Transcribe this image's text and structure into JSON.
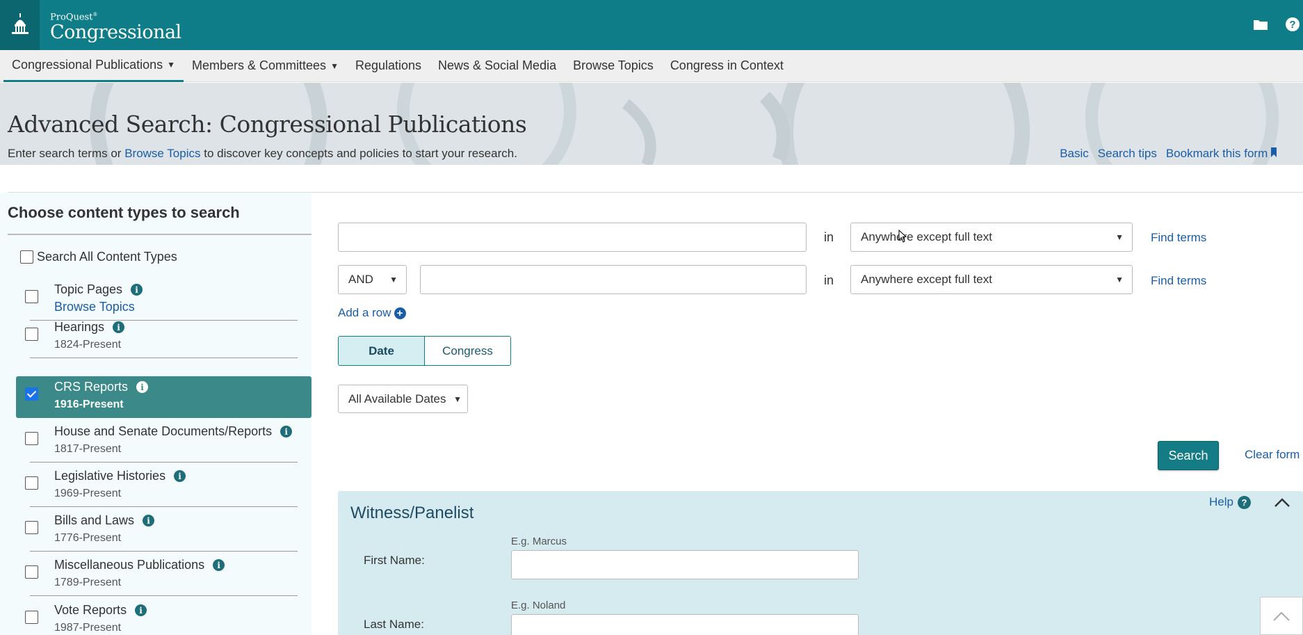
{
  "brand": {
    "small": "ProQuest",
    "big": "Congressional"
  },
  "nav": [
    {
      "label": "Congressional Publications",
      "caret": "▼"
    },
    {
      "label": "Members & Committees",
      "caret": "▼"
    },
    {
      "label": "Regulations"
    },
    {
      "label": "News & Social Media"
    },
    {
      "label": "Browse Topics"
    },
    {
      "label": "Congress in Context"
    }
  ],
  "hero": {
    "title": "Advanced Search: Congressional Publications",
    "sub_pre": "Enter search terms or",
    "sub_link": "Browse Topics",
    "sub_post": "to discover key concepts and policies to start your research.",
    "links": {
      "basic": "Basic",
      "tips": "Search tips",
      "bookmark": "Bookmark this form"
    }
  },
  "sidebar": {
    "heading": "Choose content types to search",
    "all_label": "Search All Content Types",
    "items": [
      {
        "name": "Topic Pages",
        "sub": "Browse Topics"
      },
      {
        "name": "Hearings",
        "sub": "1824-Present"
      },
      {
        "name": "CRS Reports",
        "sub": "1916-Present"
      },
      {
        "name": "House and Senate Documents/Reports",
        "sub": "1817-Present"
      },
      {
        "name": "Legislative Histories",
        "sub": "1969-Present"
      },
      {
        "name": "Bills and Laws",
        "sub": "1776-Present"
      },
      {
        "name": "Miscellaneous Publications",
        "sub": "1789-Present"
      },
      {
        "name": "Vote Reports",
        "sub": "1987-Present"
      }
    ]
  },
  "form": {
    "row1": {
      "value": "",
      "in": "in",
      "field": "Anywhere except full text",
      "find": "Find terms"
    },
    "row2": {
      "op": "AND",
      "value": "",
      "in": "in",
      "field": "Anywhere except full text",
      "find": "Find terms"
    },
    "add_row": "Add a row",
    "toggle": {
      "date": "Date",
      "congress": "Congress"
    },
    "dates": "All Available Dates",
    "search": "Search",
    "clear": "Clear form"
  },
  "witness": {
    "title": "Witness/Panelist",
    "help": "Help",
    "first_label": "First Name:",
    "first_hint": "E.g. Marcus",
    "last_label": "Last Name:",
    "last_hint": "E.g. Noland"
  },
  "colors": {
    "header": "#0f7d88",
    "selected": "#3b8a89",
    "link": "#1a5ea8"
  }
}
